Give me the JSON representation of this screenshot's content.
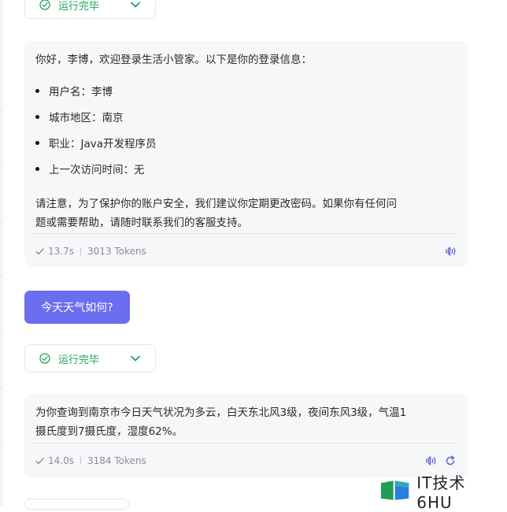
{
  "status_top": {
    "label": "运行完毕"
  },
  "message1": {
    "intro": "你好，李博，欢迎登录生活小管家。以下是你的登录信息：",
    "bullets": [
      "用户名：李博",
      "城市地区：南京",
      "职业：Java开发程序员",
      "上一次访问时间：无"
    ],
    "note_line1": "请注意，为了保护你的账户安全，我们建议你定期更改密码。如果你有任何问",
    "note_line2": "题或需要帮助，请随时联系我们的客服支持。",
    "time": "13.7s",
    "tokens": "3013 Tokens"
  },
  "user_message": {
    "text": "今天天气如何?"
  },
  "status_mid": {
    "label": "运行完毕"
  },
  "message2": {
    "line1": "为你查询到南京市今日天气状况为多云，白天东北风3级，夜间东风3级，气温1",
    "line2": "摄氏度到7摄氏度，湿度62%。",
    "time": "14.0s",
    "tokens": "3184 Tokens"
  },
  "watermark": {
    "text": "IT技术 6HU"
  },
  "colors": {
    "accent": "#6c6ef0",
    "success": "#21a35b",
    "icon": "#6366d8"
  }
}
